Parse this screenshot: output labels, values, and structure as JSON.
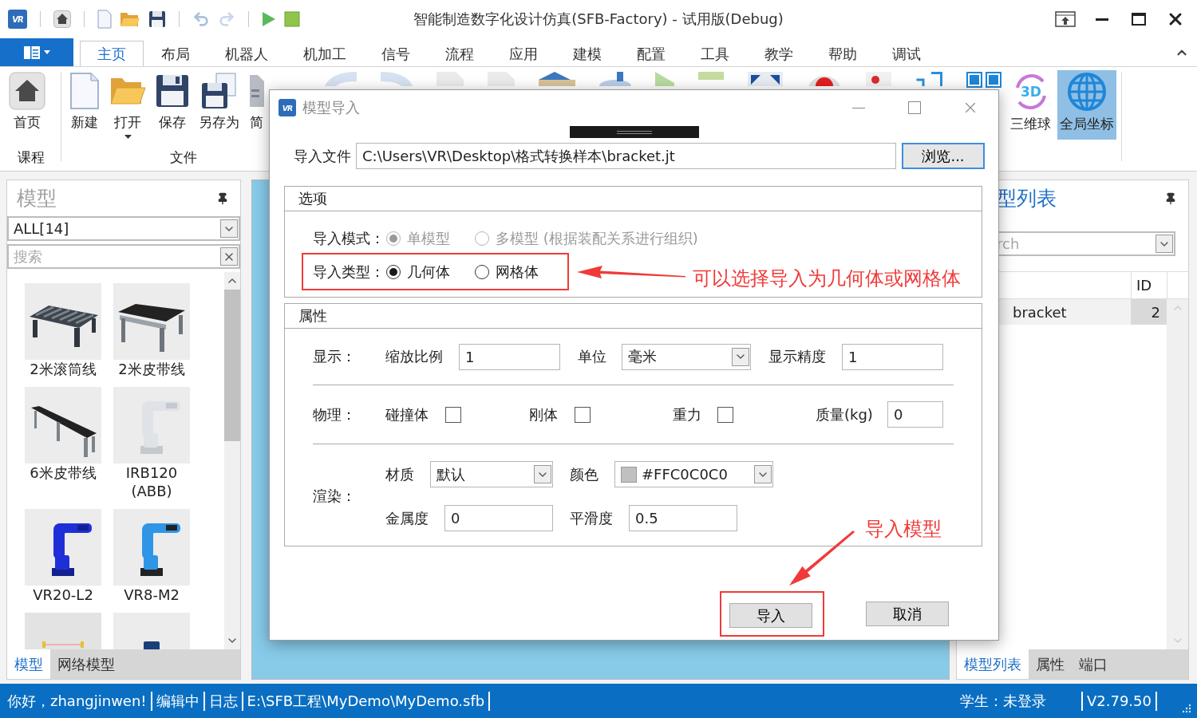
{
  "window": {
    "logo": "VR",
    "title": "智能制造数字化设计仿真(SFB-Factory) - 试用版(Debug)"
  },
  "ribbon_tabs": [
    {
      "label": "主页",
      "selected": true
    },
    {
      "label": "布局",
      "selected": false
    },
    {
      "label": "机器人",
      "selected": false
    },
    {
      "label": "机加工",
      "selected": false
    },
    {
      "label": "信号",
      "selected": false
    },
    {
      "label": "流程",
      "selected": false
    },
    {
      "label": "应用",
      "selected": false
    },
    {
      "label": "建模",
      "selected": false
    },
    {
      "label": "配置",
      "selected": false
    },
    {
      "label": "工具",
      "selected": false
    },
    {
      "label": "教学",
      "selected": false
    },
    {
      "label": "帮助",
      "selected": false
    },
    {
      "label": "调试",
      "selected": false
    }
  ],
  "ribbon": {
    "groups": [
      {
        "label": "课程",
        "items": [
          {
            "label": "首页",
            "kind": "home",
            "dropdown": false
          }
        ]
      },
      {
        "label": "文件",
        "items": [
          {
            "label": "新建",
            "kind": "new",
            "dropdown": false
          },
          {
            "label": "打开",
            "kind": "open",
            "dropdown": true
          },
          {
            "label": "保存",
            "kind": "save",
            "dropdown": false
          },
          {
            "label": "另存为",
            "kind": "saveas",
            "dropdown": false
          },
          {
            "label": "简",
            "kind": "doc",
            "dropdown": false
          }
        ]
      }
    ],
    "tools": [
      {
        "label": "三维球",
        "kind": "sphere",
        "icon_text": "3D",
        "selected": false
      },
      {
        "label": "全局坐标",
        "kind": "globe",
        "selected": true
      }
    ]
  },
  "model_panel": {
    "title": "模型",
    "filter": "ALL[14]",
    "search_placeholder": "搜索",
    "items": [
      {
        "label": "2米滚筒线",
        "kind": "picture"
      },
      {
        "label": "2米皮带线",
        "kind": "picture"
      },
      {
        "label": "6米皮带线",
        "kind": "picture"
      },
      {
        "label": "IRB120 (ABB)",
        "kind": "picture"
      },
      {
        "label": "VR20-L2",
        "kind": "picture"
      },
      {
        "label": "VR8-M2",
        "kind": "picture"
      },
      {
        "kind": "picture"
      },
      {
        "kind": "picture"
      }
    ],
    "tabs": [
      {
        "label": "模型",
        "selected": true
      },
      {
        "label": "网络模型",
        "selected": false
      }
    ]
  },
  "model_list_panel": {
    "title": "型列表",
    "search_placeholder": "rch",
    "columns": [
      "ID"
    ],
    "rows": [
      {
        "name": "bracket",
        "id": "2"
      }
    ],
    "tabs": [
      {
        "label": "模型列表",
        "selected": true
      },
      {
        "label": "属性",
        "selected": false
      },
      {
        "label": "端口",
        "selected": false
      }
    ]
  },
  "dialog": {
    "logo": "VR",
    "title": "模型导入",
    "file": {
      "label": "导入文件",
      "value": "C:\\Users\\VR\\Desktop\\格式转换样本\\bracket.jt",
      "button": "浏览..."
    },
    "options": {
      "title": "选项",
      "rows": [
        {
          "label": "导入模式：",
          "highlighted": false,
          "choices": [
            {
              "label": "单模型",
              "selected": true,
              "disabled": true
            },
            {
              "label": "多模型 (根据装配关系进行组织)",
              "selected": false,
              "disabled": true
            }
          ]
        },
        {
          "label": "导入类型：",
          "highlighted": true,
          "choices": [
            {
              "label": "几何体",
              "selected": true,
              "disabled": false
            },
            {
              "label": "网格体",
              "selected": false,
              "disabled": false
            }
          ]
        }
      ]
    },
    "properties": {
      "title": "属性",
      "display": {
        "label": "显示：",
        "scale_label": "缩放比例",
        "scale": "1",
        "unit_label": "单位",
        "unit": "毫米",
        "precision_label": "显示精度",
        "precision": "1"
      },
      "physics": {
        "label": "物理：",
        "checks": [
          {
            "label": "碰撞体",
            "checked": false
          },
          {
            "label": "刚体",
            "checked": false
          },
          {
            "label": "重力",
            "checked": false
          }
        ],
        "mass_label": "质量(kg)",
        "mass": "0"
      },
      "render": {
        "label": "渲染：",
        "material_label": "材质",
        "material": "默认",
        "color_label": "颜色",
        "color_code": "#FFC0C0C0",
        "metalness_label": "金属度",
        "metalness": "0",
        "smoothness_label": "平滑度",
        "smoothness": "0.5"
      }
    },
    "buttons": [
      {
        "label": "导入",
        "highlighted": true
      },
      {
        "label": "取消",
        "highlighted": false
      }
    ],
    "annotations": [
      "可以选择导入为几何体或网格体",
      "导入模型"
    ]
  },
  "status_bar": {
    "left": [
      "你好，zhangjinwen!",
      "编辑中",
      "日志",
      "E:\\SFB工程\\MyDemo\\MyDemo.sfb"
    ],
    "right": [
      "学生：未登录",
      "V2.79.50"
    ]
  }
}
